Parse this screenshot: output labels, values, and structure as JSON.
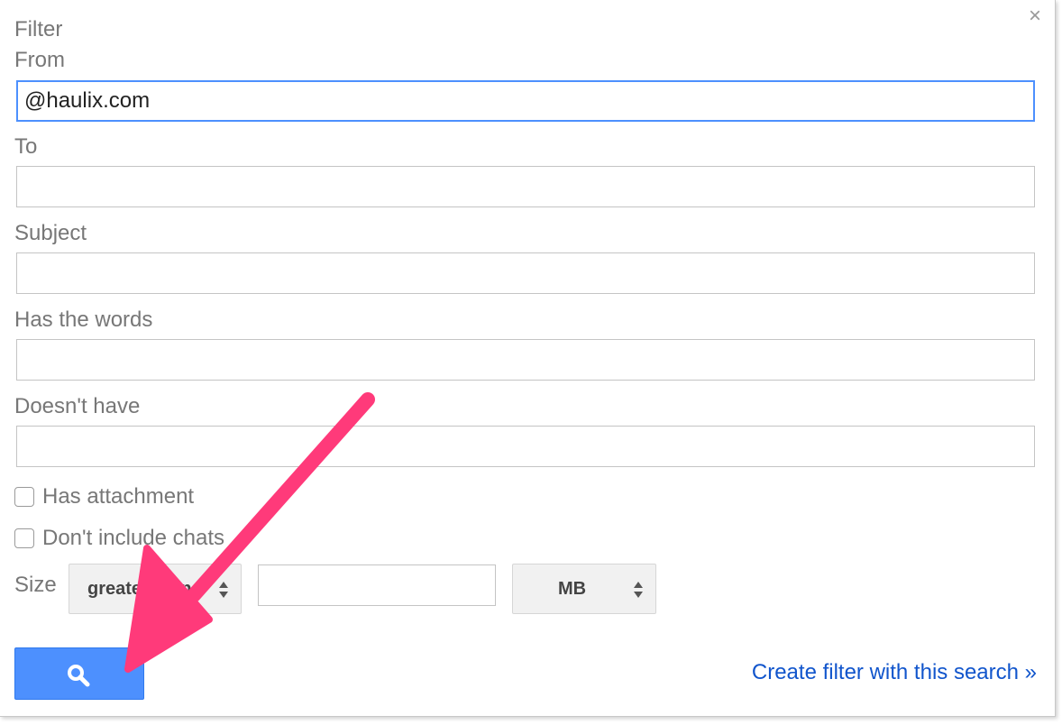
{
  "dialog": {
    "title": "Filter",
    "close_glyph": "×",
    "icons": {
      "close": "close-icon",
      "search": "search-icon",
      "spinner": "up-down-arrows-icon"
    }
  },
  "fields": {
    "from": {
      "label": "From",
      "value": "@haulix.com"
    },
    "to": {
      "label": "To",
      "value": ""
    },
    "subject": {
      "label": "Subject",
      "value": ""
    },
    "has_words": {
      "label": "Has the words",
      "value": ""
    },
    "doesnt_have": {
      "label": "Doesn't have",
      "value": ""
    }
  },
  "checkboxes": {
    "has_attachment": {
      "label": "Has attachment",
      "checked": false
    },
    "dont_include_chats": {
      "label": "Don't include chats",
      "checked": false
    }
  },
  "size": {
    "label": "Size",
    "comparator": "greater than",
    "value": "",
    "unit": "MB"
  },
  "actions": {
    "create_filter_link": "Create filter with this search »"
  },
  "colors": {
    "button_blue": "#4d90fe",
    "link_blue": "#1155cc",
    "focus_border": "#4d90fe",
    "annotation_arrow": "#ff3a7a"
  }
}
